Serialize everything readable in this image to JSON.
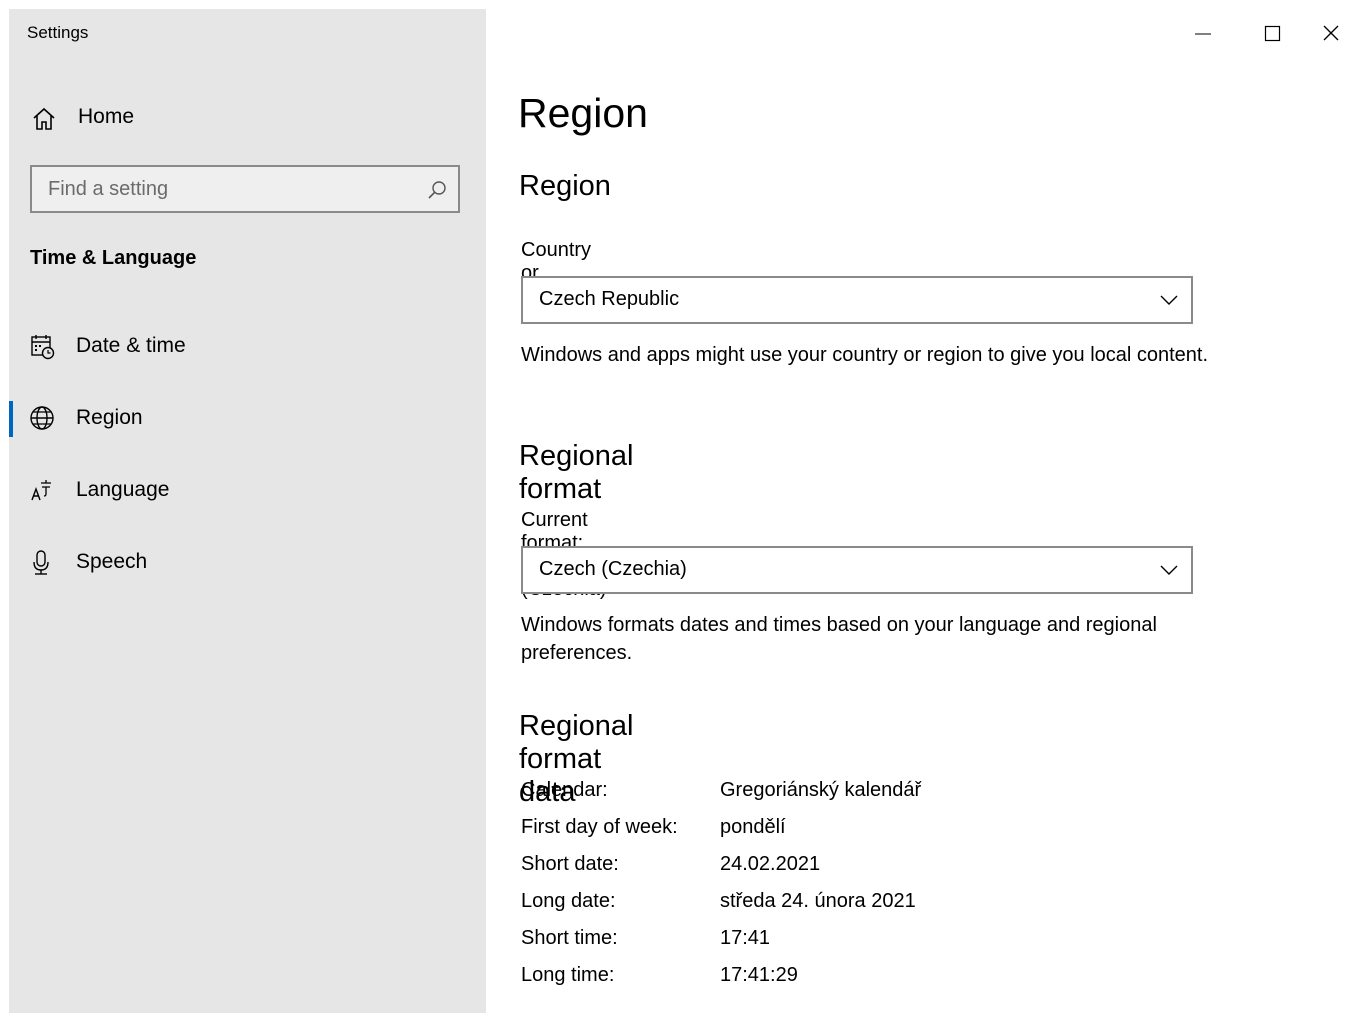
{
  "window": {
    "app_title": "Settings"
  },
  "sidebar": {
    "home_label": "Home",
    "search_placeholder": "Find a setting",
    "section_title": "Time & Language",
    "items": [
      {
        "label": "Date & time",
        "icon": "calendar-clock-icon",
        "selected": false
      },
      {
        "label": "Region",
        "icon": "globe-icon",
        "selected": true
      },
      {
        "label": "Language",
        "icon": "language-icon",
        "selected": false
      },
      {
        "label": "Speech",
        "icon": "microphone-icon",
        "selected": false
      }
    ]
  },
  "main": {
    "page_title": "Region",
    "region": {
      "heading": "Region",
      "field_label": "Country or region",
      "selected_value": "Czech Republic",
      "description": "Windows and apps might use your country or region to give you local content."
    },
    "regional_format": {
      "heading": "Regional format",
      "field_label": "Current format: Czech (Czechia)",
      "selected_value": "Czech (Czechia)",
      "description": "Windows formats dates and times based on your language and regional preferences."
    },
    "format_data": {
      "heading": "Regional format data",
      "rows": [
        {
          "key": "Calendar:",
          "value": "Gregoriánský kalendář"
        },
        {
          "key": "First day of week:",
          "value": "pondělí"
        },
        {
          "key": "Short date:",
          "value": "24.02.2021"
        },
        {
          "key": "Long date:",
          "value": "středa 24. února 2021"
        },
        {
          "key": "Short time:",
          "value": "17:41"
        },
        {
          "key": "Long time:",
          "value": "17:41:29"
        }
      ]
    }
  },
  "colors": {
    "sidebar_bg": "#e6e6e6",
    "accent": "#0067c0",
    "border": "#8a8a8a"
  }
}
